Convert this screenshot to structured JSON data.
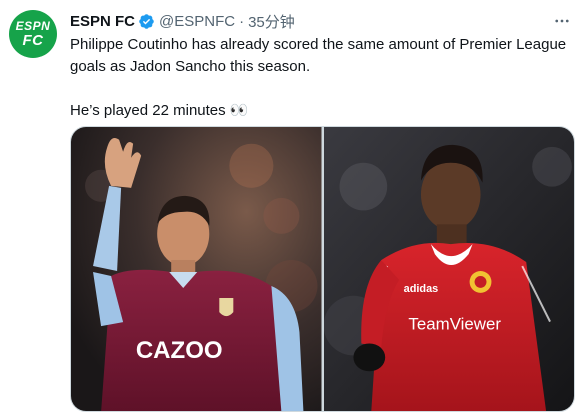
{
  "tweet": {
    "author": {
      "display_name": "ESPN FC",
      "handle": "@ESPNFC",
      "separator": "·",
      "timestamp": "35分钟",
      "verified": true,
      "avatar": {
        "line1": "ESPN",
        "line2": "FC",
        "color": "#16a34a"
      }
    },
    "text": {
      "paragraph1": "Philippe Coutinho has already scored the same amount of Premier League goals as Jadon Sancho this season.",
      "paragraph2": "He’s played 22 minutes 👀"
    },
    "more_icon": "ellipsis-icon",
    "media": [
      {
        "name": "coutinho-photo",
        "sponsor_text": "CAZOO",
        "icon": "photo"
      },
      {
        "name": "sancho-photo",
        "sponsor_text": "TeamViewer",
        "brand_text": "adidas",
        "icon": "photo"
      }
    ]
  },
  "colors": {
    "verified": "#1d9bf0",
    "text_primary": "#0f1419",
    "text_secondary": "#536471"
  }
}
